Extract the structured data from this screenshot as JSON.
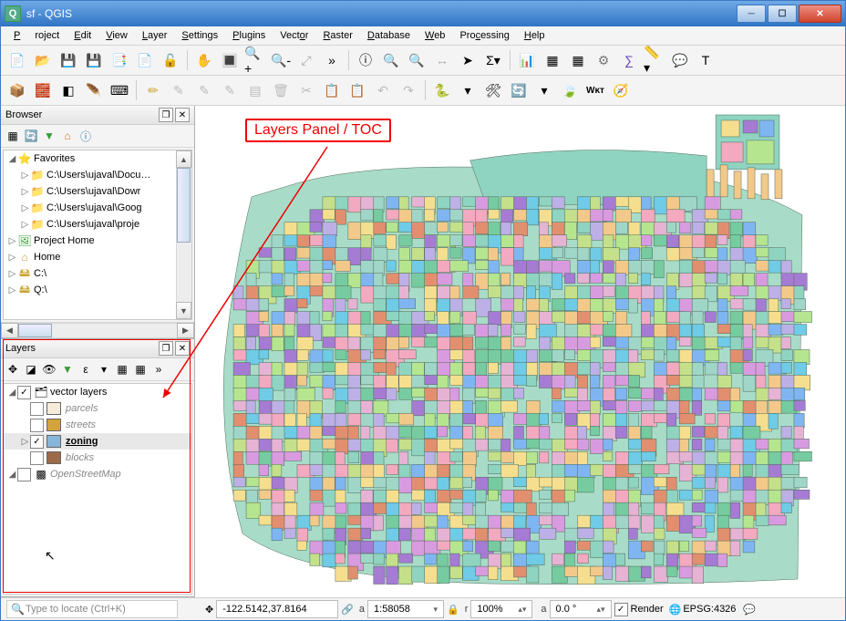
{
  "window": {
    "title": "sf - QGIS"
  },
  "menu": {
    "items": [
      "Project",
      "Edit",
      "View",
      "Layer",
      "Settings",
      "Plugins",
      "Vector",
      "Raster",
      "Database",
      "Web",
      "Processing",
      "Help"
    ]
  },
  "toolbars": {
    "row1_icons": [
      "📄",
      "📂",
      "💾",
      "💾",
      "📑",
      "📄",
      "🔓"
    ],
    "row1b_icons": [
      "✋",
      "🔳",
      "🔍+",
      "🔍-",
      "⤢",
      "»"
    ],
    "row1c_icons": [
      "ⓘ",
      "🔍",
      "🔍",
      "↔",
      "➤",
      "Σ▾"
    ],
    "row1d_icons": [
      "📊",
      "▦",
      "▦",
      "⚙",
      "∑",
      "📏▾",
      "💬",
      "T"
    ],
    "row2_icons": [
      "📦",
      "🧱",
      "◧",
      "🪶",
      "⌨"
    ],
    "row2b_icons": [
      "✏",
      "✎",
      "✎",
      "✎",
      "▤",
      "🗑",
      "✂",
      "📋",
      "📋",
      "↶",
      "↷"
    ],
    "row2c_icons": [
      "🐍",
      "▾",
      "🛠",
      "🔄",
      "▾",
      "🍃",
      "Wᴋᴛ",
      "🧭"
    ]
  },
  "browser": {
    "title": "Browser",
    "tool_icons": [
      "▦",
      "🔄",
      "▼",
      "⌂",
      "ⓘ"
    ],
    "tree": [
      {
        "exp": "◢",
        "icon": "⭐",
        "label": "Favorites",
        "color": "#e6b800"
      },
      {
        "exp": "▷",
        "icon": "📁",
        "label": "C:\\Users\\ujaval\\Docu…",
        "indent": 1
      },
      {
        "exp": "▷",
        "icon": "📁",
        "label": "C:\\Users\\ujaval\\Dowr",
        "indent": 1
      },
      {
        "exp": "▷",
        "icon": "📁",
        "label": "C:\\Users\\ujaval\\Goog",
        "indent": 1
      },
      {
        "exp": "▷",
        "icon": "📁",
        "label": "C:\\Users\\ujaval\\proje",
        "indent": 1
      },
      {
        "exp": "▷",
        "icon": "🖼",
        "label": "Project Home",
        "indent": 0,
        "color": "#3a9d3a"
      },
      {
        "exp": "▷",
        "icon": "⌂",
        "label": "Home",
        "indent": 0
      },
      {
        "exp": "▷",
        "icon": "🖴",
        "label": "C:\\",
        "indent": 0
      },
      {
        "exp": "▷",
        "icon": "🖴",
        "label": "Q:\\",
        "indent": 0
      },
      {
        "exp": "",
        "icon": "",
        "label": "",
        "indent": 0
      }
    ]
  },
  "layers": {
    "title": "Layers",
    "tool_icons": [
      "✥",
      "◪",
      "👁",
      "▼",
      "ε",
      "▾",
      "▦",
      "▦",
      "»"
    ],
    "tree": [
      {
        "exp": "◢",
        "chk": "✓",
        "icon": "🗂",
        "label": "vector layers",
        "indent": 0
      },
      {
        "exp": "",
        "chk": "",
        "icon": "▱",
        "label": "parcels",
        "indent": 1,
        "style": "italic-grey",
        "sw": "#f4ecd8"
      },
      {
        "exp": "",
        "chk": "",
        "icon": "—",
        "label": "streets",
        "indent": 1,
        "style": "italic-grey",
        "sw": "#d6a23b"
      },
      {
        "exp": "▷",
        "chk": "✓",
        "icon": "◫",
        "label": "zoning",
        "indent": 1,
        "style": "bold-under",
        "sw": "#87b6d9",
        "selected": true
      },
      {
        "exp": "",
        "chk": "",
        "icon": "■",
        "label": "blocks",
        "indent": 1,
        "style": "italic-grey",
        "sw": "#9c6a48"
      },
      {
        "exp": "◢",
        "chk": "",
        "icon": "▩",
        "label": "OpenStreetMap",
        "indent": 0,
        "style": "italic-grey"
      }
    ]
  },
  "annotation": {
    "label": "Layers Panel / TOC"
  },
  "status": {
    "locate_placeholder": "Type to locate (Ctrl+K)",
    "coord_label": "",
    "coord_value": "-122.5142,37.8164",
    "scale_label": "a",
    "scale_value": "1:58058",
    "lock_icon": "🔒",
    "mag_label": "r",
    "mag_value": "100%",
    "rot_label": "a",
    "rot_value": "0.0 °",
    "render_checked": "✓",
    "render_label": "Render",
    "crs_icon": "🌐",
    "crs_value": "EPSG:4326",
    "msg_icon": "💬"
  }
}
